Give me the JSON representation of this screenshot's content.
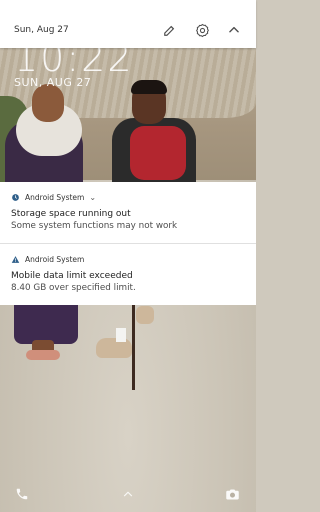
{
  "lockscreen": {
    "time": "10:22",
    "date": "SUN, AUG 27"
  },
  "quick_settings": {
    "date": "Sun, Aug 27"
  },
  "notifications": [
    {
      "app": "Android System",
      "title": "Storage space running out",
      "body": "Some system functions may not work",
      "icon": "storage-icon"
    },
    {
      "app": "Android System",
      "title": "Mobile data limit exceeded",
      "body": "8.40 GB over specified limit.",
      "icon": "warning-icon"
    }
  ],
  "colors": {
    "accent": "#3c6ea8",
    "card_bg": "#ffffff",
    "title": "#1e1e1e",
    "body": "#4d4d4d"
  },
  "icons": {
    "edit": "pencil-icon",
    "settings": "gear-icon",
    "collapse": "chevron-up-icon",
    "phone": "phone-icon",
    "camera": "camera-icon"
  }
}
